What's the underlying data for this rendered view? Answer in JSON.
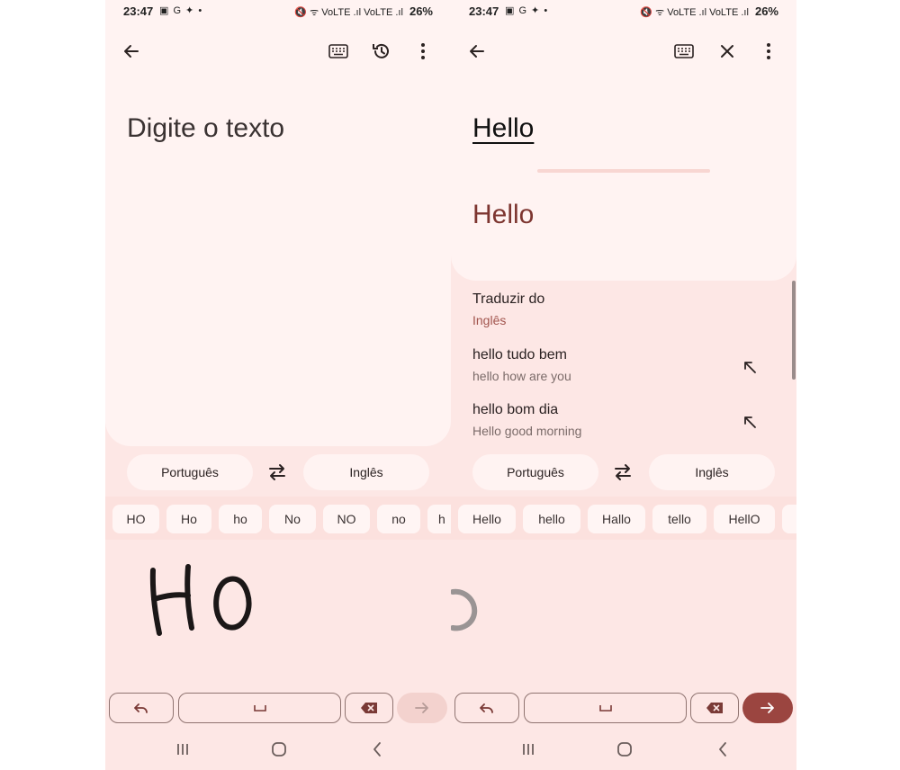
{
  "left": {
    "status": {
      "time": "23:47",
      "battery": "26%",
      "icons_left": "▣ G ✦ •",
      "icons_right": "🔇 ᯤ VoLTE .ıl VoLTE .ıl"
    },
    "placeholder": "Digite o texto",
    "source_lang": "Português",
    "target_lang": "Inglês",
    "candidates": [
      "HO",
      "Ho",
      "ho",
      "No",
      "NO",
      "no",
      "h"
    ],
    "handwriting": "HO"
  },
  "right": {
    "status": {
      "time": "23:47",
      "battery": "26%",
      "icons_left": "▣ G ✦ •",
      "icons_right": "🔇 ᯤ VoLTE .ıl VoLTE .ıl"
    },
    "source_text": "Hello",
    "translated_text": "Hello",
    "suggestions": [
      {
        "title": "Traduzir do",
        "subtitle": "Inglês"
      },
      {
        "title": "hello tudo bem",
        "subtitle": "hello how are you"
      },
      {
        "title": "hello bom dia",
        "subtitle": "Hello good morning"
      }
    ],
    "source_lang": "Português",
    "target_lang": "Inglês",
    "candidates": [
      "Hello",
      "hello",
      "Hallo",
      "tello",
      "HellO",
      ""
    ]
  },
  "colors": {
    "accent": "#9b4540",
    "background": "#fde7e5",
    "card": "#fff3f2"
  }
}
